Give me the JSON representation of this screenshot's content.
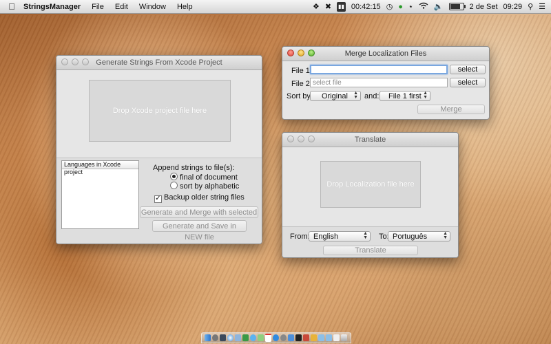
{
  "menubar": {
    "app_name": "StringsManager",
    "menus": [
      "File",
      "Edit",
      "Window",
      "Help"
    ],
    "clock": "00:42:15",
    "date": "2 de Set",
    "time": "09:29"
  },
  "generate_window": {
    "title": "Generate Strings From Xcode Project",
    "dropzone": "Drop Xcode project file here",
    "languages_header": "Languages in Xcode project",
    "append_label": "Append strings to file(s):",
    "radio_final": "final of document",
    "radio_alpha": "sort by alphabetic",
    "backup_label": "Backup older string files",
    "btn_merge": "Generate and Merge with selected files",
    "btn_save": "Generate and Save in NEW file"
  },
  "merge_window": {
    "title": "Merge Localization Files",
    "file1_label": "File 1:",
    "file1_value": "",
    "file2_label": "File 2:",
    "file2_placeholder": "select file",
    "select1": "select",
    "select2": "select",
    "sortby_label": "Sort by:",
    "sortby_value": "Original",
    "and_label": "and:",
    "and_value": "File 1 first",
    "merge_button": "Merge"
  },
  "translate_window": {
    "title": "Translate",
    "dropzone": "Drop Localization file here",
    "from_label": "From:",
    "from_value": "English",
    "to_label": "To:",
    "to_value": "Português",
    "translate_button": "Translate"
  },
  "icons": {
    "apple": "apple-logo-icon",
    "wifi": "wifi-icon",
    "volume": "volume-icon",
    "battery": "battery-icon",
    "search": "spotlight-search-icon",
    "list": "notification-list-icon"
  }
}
